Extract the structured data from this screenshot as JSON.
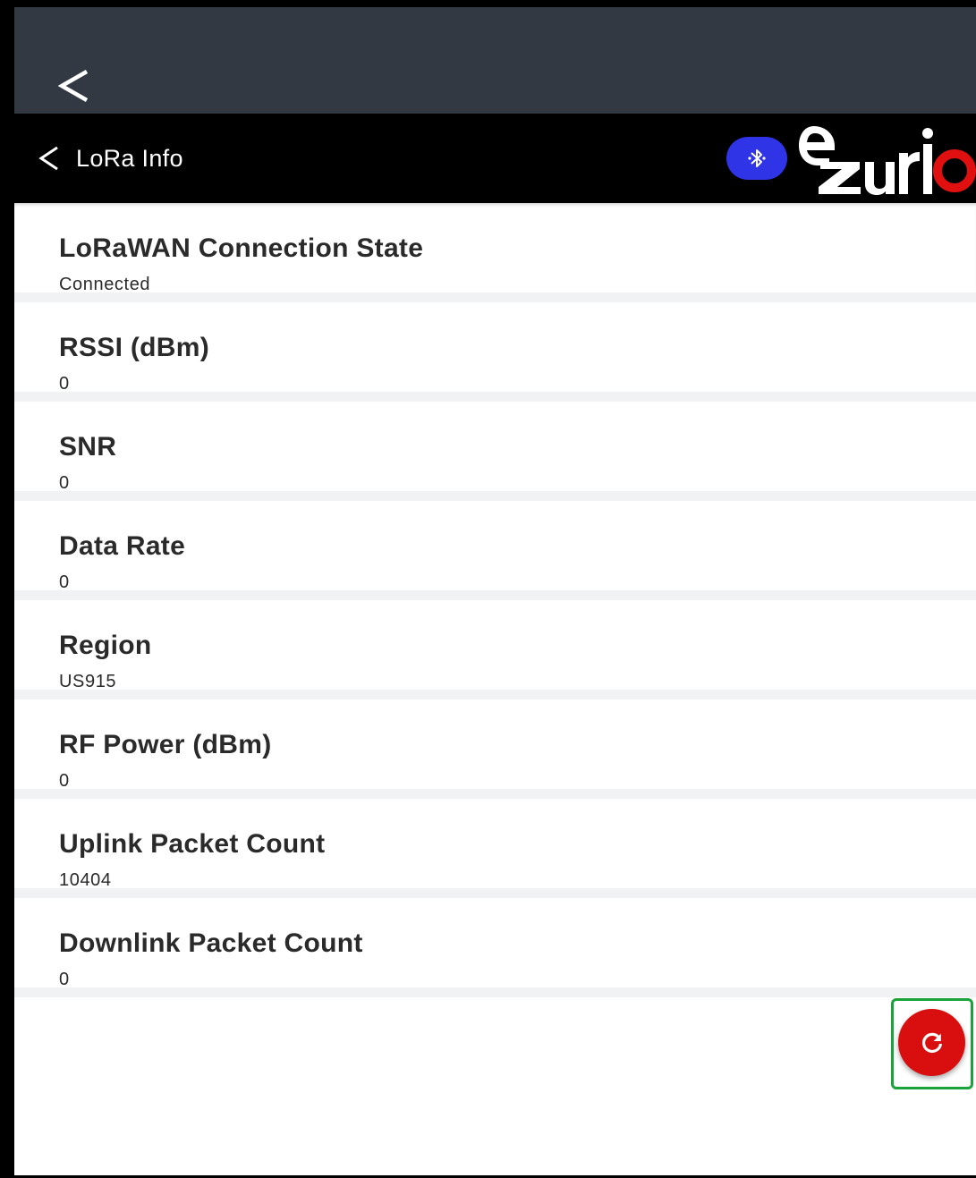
{
  "toolbar": {
    "title": "LoRa Info",
    "brand_logo_text": "ezurio",
    "bluetooth_icon": "bluetooth-icon"
  },
  "colors": {
    "status_bar": "#323942",
    "toolbar": "#000000",
    "bluetooth_pill": "#2f34e6",
    "brand_red": "#e01010",
    "fab": "#d90f0f",
    "fab_highlight": "#1aa33a"
  },
  "items": [
    {
      "title": "LoRaWAN Connection State",
      "value": "Connected"
    },
    {
      "title": "RSSI (dBm)",
      "value": "0"
    },
    {
      "title": "SNR",
      "value": "0"
    },
    {
      "title": "Data Rate",
      "value": "0"
    },
    {
      "title": "Region",
      "value": "US915"
    },
    {
      "title": "RF Power (dBm)",
      "value": "0"
    },
    {
      "title": "Uplink Packet Count",
      "value": "10404"
    },
    {
      "title": "Downlink Packet Count",
      "value": "0"
    }
  ],
  "fab": {
    "icon": "refresh-icon"
  }
}
